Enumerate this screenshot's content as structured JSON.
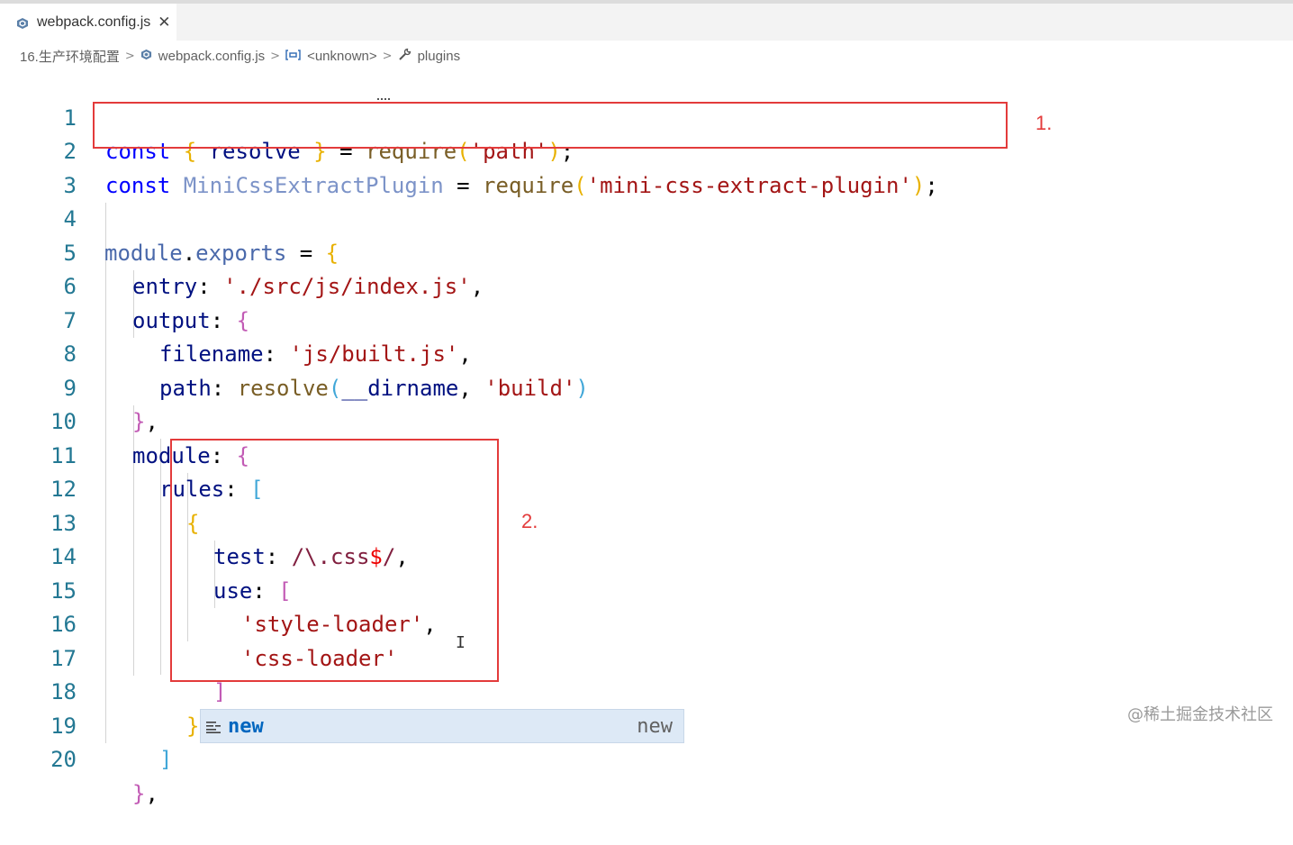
{
  "tab": {
    "filename": "webpack.config.js",
    "close_glyph": "✕",
    "icon": "settings-file-icon"
  },
  "breadcrumb": {
    "folder": "16.生产环境配置",
    "file": "webpack.config.js",
    "symbol1": "<unknown>",
    "symbol2": "plugins",
    "separator": ">"
  },
  "code": {
    "line_numbers": [
      "1",
      "2",
      "3",
      "4",
      "5",
      "6",
      "7",
      "8",
      "9",
      "10",
      "11",
      "12",
      "13",
      "14",
      "15",
      "16",
      "17",
      "18",
      "19",
      "20"
    ],
    "l1": {
      "kw": "const",
      "b_open": "{",
      "name": "resolve",
      "b_close": "}",
      "eq": "=",
      "fn": "require",
      "p_open": "(",
      "str": "'path'",
      "p_close": ")",
      "semi": ";"
    },
    "l2": {
      "kw": "const",
      "name": "MiniCssExtractPlugin",
      "eq": "=",
      "fn": "require",
      "p_open": "(",
      "str": "'mini-css-extract-plugin'",
      "p_close": ")",
      "semi": ";"
    },
    "l4": {
      "obj": "module",
      "dot": ".",
      "prop": "exports",
      "eq": "=",
      "b_open": "{"
    },
    "l5": {
      "key": "entry",
      "colon": ":",
      "str": "'./src/js/index.js'",
      "comma": ","
    },
    "l6": {
      "key": "output",
      "colon": ":",
      "b_open": "{"
    },
    "l7": {
      "key": "filename",
      "colon": ":",
      "str": "'js/built.js'",
      "comma": ","
    },
    "l8": {
      "key": "path",
      "colon": ":",
      "fn": "resolve",
      "p_open": "(",
      "arg": "__dirname",
      "comma": ",",
      "str": "'build'",
      "p_close": ")"
    },
    "l9": {
      "b_close": "}",
      "comma": ","
    },
    "l10": {
      "key": "module",
      "colon": ":",
      "b_open": "{"
    },
    "l11": {
      "key": "rules",
      "colon": ":",
      "br_open": "["
    },
    "l12": {
      "b_open": "{"
    },
    "l13": {
      "key": "test",
      "colon": ":",
      "re_a": "/\\.css",
      "re_b": "$",
      "re_c": "/",
      "comma": ","
    },
    "l14": {
      "key": "use",
      "colon": ":",
      "br_open": "["
    },
    "l15": {
      "str": "'style-loader'",
      "comma": ","
    },
    "l16": {
      "str": "'css-loader'"
    },
    "l17": {
      "br_close": "]"
    },
    "l18": {
      "b_close": "}"
    },
    "l19": {
      "br_close": "]"
    },
    "l20": {
      "b_close": "}",
      "comma": ","
    }
  },
  "annotations": {
    "label1": "1.",
    "label2": "2."
  },
  "suggestion": {
    "icon": "snippet-icon",
    "label": "new",
    "detail": "new"
  },
  "mouse_cursor": "I",
  "watermark": "@稀土掘金技术社区",
  "colors": {
    "annotation_red": "#e33b3b",
    "line_number": "#237893",
    "keyword": "#0000ff",
    "string": "#a31515",
    "suggest_bg": "#dde9f6"
  }
}
